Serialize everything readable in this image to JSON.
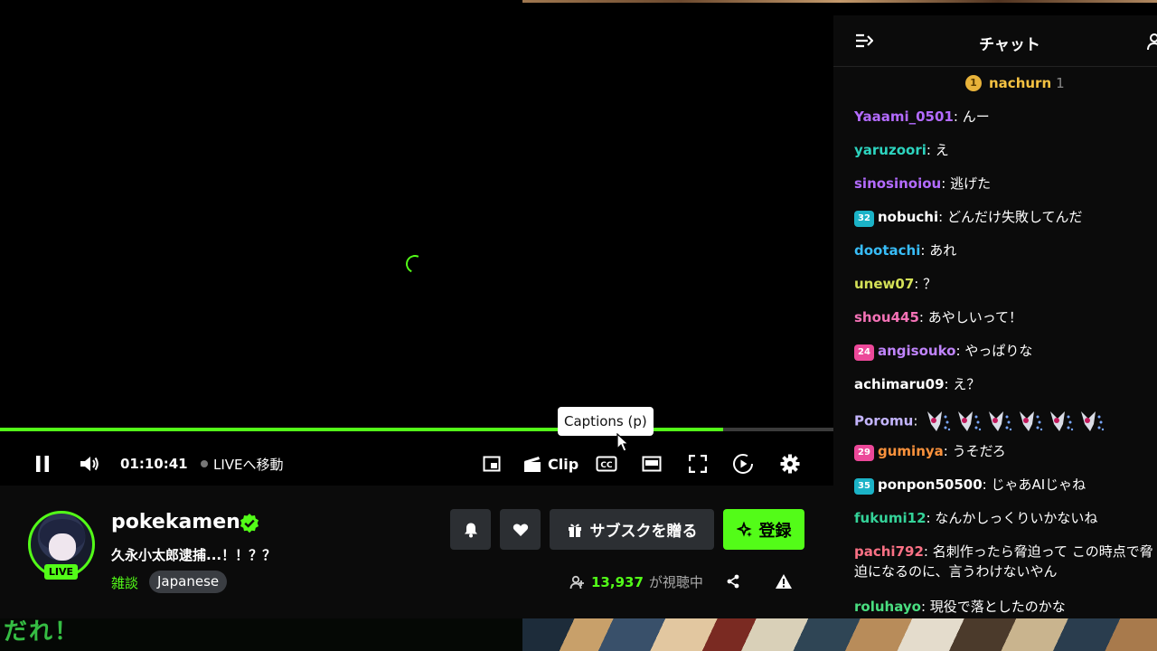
{
  "background": {
    "left_text": "だれ！"
  },
  "player": {
    "progress_fraction": 0.868,
    "tooltip": "Captions (p)",
    "time": "01:10:41",
    "live_jump": "LIVEへ移動",
    "clip_label": "Clip"
  },
  "channel": {
    "name": "pokekamen",
    "live_badge": "LIVE",
    "title": "久永小太郎逮捕...！！？？",
    "category": "雑談",
    "tag": "Japanese",
    "subscribe_gift": "サブスクを贈る",
    "follow": "登録",
    "viewers": "13,937",
    "viewers_label": "が視聴中"
  },
  "chat": {
    "title": "チャット",
    "pinned": {
      "rank": "1",
      "user": "nachurn",
      "count": "1"
    },
    "messages": [
      {
        "user": "Yaaami_0501",
        "color": "#b36bff",
        "text": "んー"
      },
      {
        "user": "yaruzoori",
        "color": "#2dd4bf",
        "text": "え"
      },
      {
        "user": "sinosinoiou",
        "color": "#b36bff",
        "text": "逃げた"
      },
      {
        "user": "nobuchi",
        "color": "#ffffff",
        "badge": "32",
        "badge_color": "#1bb3c7",
        "text": "どんだけ失敗してんだ"
      },
      {
        "user": "dootachi",
        "color": "#38bdf8",
        "text": "あれ"
      },
      {
        "user": "unew07",
        "color": "#d4e157",
        "text": "？"
      },
      {
        "user": "shou445",
        "color": "#f472b6",
        "text": "あやしいって！"
      },
      {
        "user": "angisouko",
        "color": "#c084fc",
        "badge": "24",
        "badge_color": "#ec4899",
        "text": "やっぱりな"
      },
      {
        "user": "achimaru09",
        "color": "#ffffff",
        "text": "え？"
      },
      {
        "user": "Poromu",
        "color": "#c4b5fd",
        "text": "",
        "emotes": 6
      },
      {
        "user": "guminya",
        "color": "#fb923c",
        "badge": "29",
        "badge_color": "#ec4899",
        "text": "うそだろ"
      },
      {
        "user": "ponpon50500",
        "color": "#ffffff",
        "badge": "35",
        "badge_color": "#1bb3c7",
        "text": "じゃあAIじゃね"
      },
      {
        "user": "fukumi12",
        "color": "#34d399",
        "text": "なんかしっくりいかないね"
      },
      {
        "user": "pachi792",
        "color": "#fb7185",
        "text": "名刺作ったら脅迫って この時点で脅迫になるのに、言うわけないやん"
      },
      {
        "user": "roluhayo",
        "color": "#4ade80",
        "text": "現役で落としたのかな"
      }
    ]
  }
}
